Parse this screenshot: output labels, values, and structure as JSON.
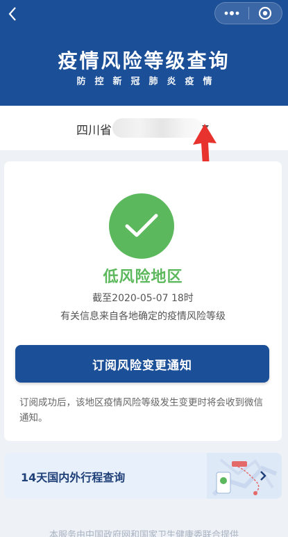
{
  "header": {
    "title": "疫情风险等级查询",
    "subtitle": "防控新冠肺炎疫情",
    "background": "#1b4f98"
  },
  "region": {
    "province": "四川省"
  },
  "status": {
    "level": "低风险地区",
    "level_color": "#5cb85c",
    "as_of": "截至2020-05-07 18时",
    "source_note": "有关信息来自各地确定的疫情风险等级"
  },
  "subscribe": {
    "button_label": "订阅风险变更通知",
    "note": "订阅成功后，该地区疫情风险等级发生变更时将会收到微信通知。"
  },
  "itinerary": {
    "label": "14天国内外行程查询"
  },
  "footer": {
    "text": "本服务由中国政府网和国家卫生健康委联合提供"
  },
  "icons": {
    "back": "chevron-left-icon",
    "more": "more-dots-icon",
    "close": "target-circle-icon",
    "status": "check-icon",
    "caret": "caret-down-icon",
    "go": "chevron-right-icon"
  }
}
